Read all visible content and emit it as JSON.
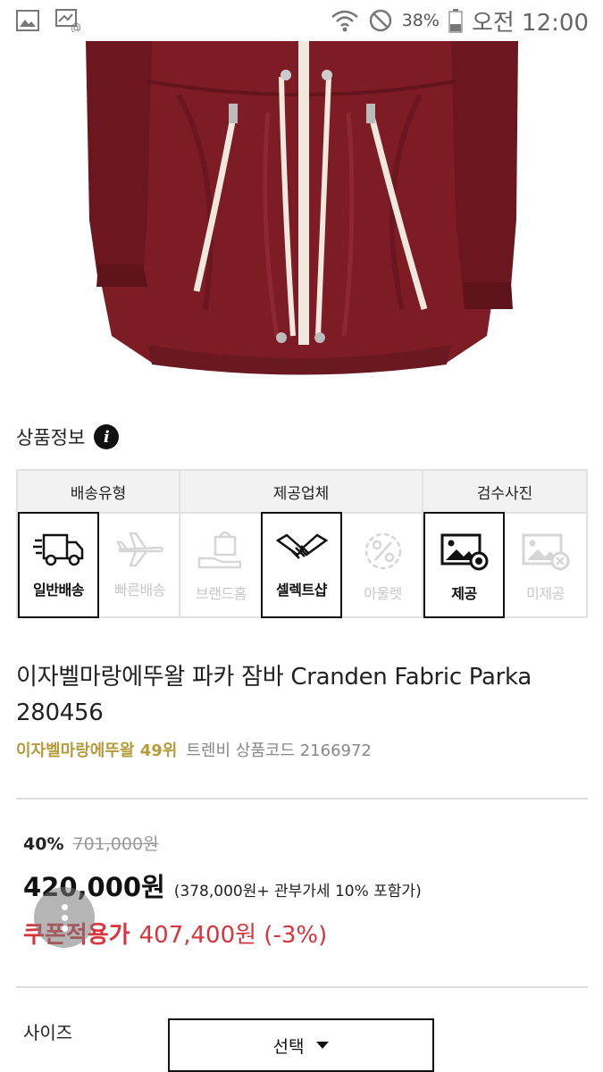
{
  "status_bar": {
    "battery_percent": "38%",
    "time": "오전 12:00",
    "icons": [
      "image-icon",
      "email-icon",
      "wifi-icon",
      "do-not-disturb-icon",
      "battery-icon"
    ]
  },
  "product_info": {
    "section_title": "상품정보",
    "headers": [
      "배송유형",
      "제공업체",
      "검수사진"
    ],
    "cells": [
      {
        "label": "일반배송",
        "icon": "truck-icon",
        "active": true
      },
      {
        "label": "빠른배송",
        "icon": "airplane-icon",
        "active": false
      },
      {
        "label": "브랜드홈",
        "icon": "shopping-bag-hand-icon",
        "active": false
      },
      {
        "label": "셀렉트샵",
        "icon": "handshake-icon",
        "active": true
      },
      {
        "label": "아울렛",
        "icon": "percent-badge-icon",
        "active": false
      },
      {
        "label": "제공",
        "icon": "photo-check-icon",
        "active": true
      },
      {
        "label": "미제공",
        "icon": "photo-x-icon",
        "active": false
      }
    ]
  },
  "product": {
    "title": "이자벨마랑에뚜왈 파카 잠바 Cranden Fabric Parka 280456",
    "brand_rank": "이자벨마랑에뚜왈 49위",
    "code_text": "트렌비 상품코드 2166972",
    "image_colors": {
      "jacket": "#7e1c26",
      "trim": "#efe8dc"
    }
  },
  "pricing": {
    "discount_rate": "40%",
    "original_price": "701,000원",
    "sale_price": "420,000원",
    "tax_note": "(378,000원+ 관부가세 10% 포함가)",
    "coupon_label": "쿠폰적용가",
    "coupon_price": "407,400원 (-3%)",
    "coupon_color": "#d9343b"
  },
  "size": {
    "label": "사이즈",
    "select_value": "선택"
  }
}
